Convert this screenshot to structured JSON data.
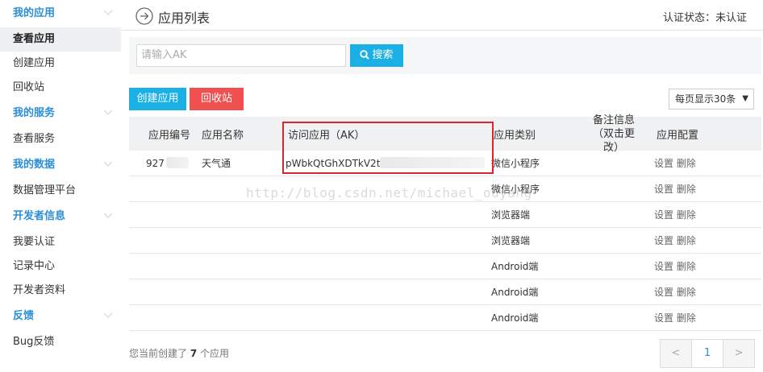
{
  "sidebar": {
    "sections": [
      {
        "title": "我的应用",
        "items": [
          "查看应用",
          "创建应用",
          "回收站"
        ]
      },
      {
        "title": "我的服务",
        "items": [
          "查看服务"
        ]
      },
      {
        "title": "我的数据",
        "items": [
          "数据管理平台"
        ]
      },
      {
        "title": "开发者信息",
        "items": [
          "我要认证",
          "记录中心",
          "开发者资料"
        ]
      },
      {
        "title": "反馈",
        "items": [
          "Bug反馈"
        ]
      }
    ]
  },
  "header": {
    "title": "应用列表",
    "status": "认证状态：未认证"
  },
  "search": {
    "placeholder": "请输入AK",
    "button": "搜索"
  },
  "actions": {
    "create": "创建应用",
    "recycle": "回收站",
    "page_size": "每页显示30条"
  },
  "table": {
    "columns": {
      "id": "应用编号",
      "name": "应用名称",
      "ak": "访问应用（AK）",
      "type": "应用类别",
      "notes_line1": "备注信息",
      "notes_line2": "（双击更改）",
      "config": "应用配置"
    },
    "rows": [
      {
        "id": "927",
        "name": "天气通",
        "ak": "pWbkQtGhXDTkV2t",
        "type": "微信小程序"
      },
      {
        "id": "",
        "name": "",
        "ak": "",
        "type": "微信小程序"
      },
      {
        "id": "",
        "name": "",
        "ak": "",
        "type": "浏览器端"
      },
      {
        "id": "",
        "name": "",
        "ak": "",
        "type": "浏览器端"
      },
      {
        "id": "",
        "name": "",
        "ak": "",
        "type": "Android端"
      },
      {
        "id": "",
        "name": "",
        "ak": "",
        "type": "Android端"
      },
      {
        "id": "",
        "name": "",
        "ak": "",
        "type": "Android端"
      }
    ],
    "config_set": "设置",
    "config_delete": "删除"
  },
  "watermark": "http://blog.csdn.net/michael_ouyang",
  "footer": {
    "prefix": "您当前创建了",
    "count": "7",
    "suffix": "个应用"
  },
  "pager": {
    "prev": "<",
    "current": "1",
    "next": ">"
  },
  "colors": {
    "accent": "#1ab0e5",
    "danger": "#f05050",
    "link": "#2a8fd6",
    "highlight": "#d9262e"
  }
}
